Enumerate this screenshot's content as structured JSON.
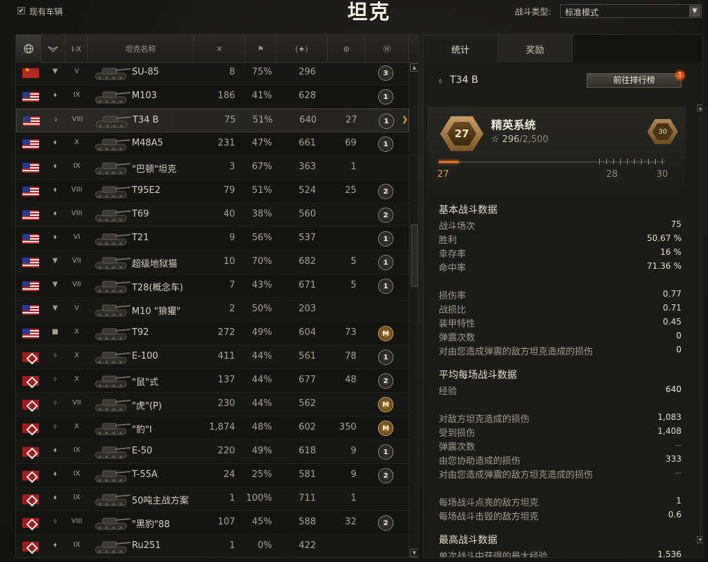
{
  "header": {
    "owned_filter_label": "现有车辆",
    "owned_filter_checked": true,
    "title": "坦克",
    "battle_type_label": "战斗类型:",
    "battle_type_value": "标准模式"
  },
  "columns": {
    "nation_icon": "globe-icon",
    "class_icon": "vehicle-class-icon",
    "tier_label": "I-X",
    "name_label": "坦克名称",
    "battles_icon": "crossed-swords-icon",
    "wins_icon": "flag-icon",
    "xp_icon": "star-icon",
    "marks_icon": "gun-marks-icon",
    "mastery_icon": "mastery-icon"
  },
  "tanks": [
    {
      "nation": "ussr",
      "cls": "▼",
      "tier": "V",
      "name": "SU-85",
      "battles": "8",
      "win": "75%",
      "xp": "296",
      "marks": "",
      "mastery": "3"
    },
    {
      "nation": "usa",
      "cls": "⬧",
      "tier": "IX",
      "name": "M103",
      "battles": "186",
      "win": "41%",
      "xp": "628",
      "marks": "",
      "mastery": "1"
    },
    {
      "nation": "usa",
      "cls": "⬨",
      "tier": "VIII",
      "name": "T34 B",
      "battles": "75",
      "win": "51%",
      "xp": "640",
      "marks": "27",
      "mastery": "1"
    },
    {
      "nation": "usa",
      "cls": "⬧",
      "tier": "X",
      "name": "M48A5",
      "battles": "231",
      "win": "47%",
      "xp": "661",
      "marks": "69",
      "mastery": "1"
    },
    {
      "nation": "usa",
      "cls": "⬧",
      "tier": "IX",
      "name": "\"巴顿\"坦克",
      "battles": "3",
      "win": "67%",
      "xp": "363",
      "marks": "1",
      "mastery": ""
    },
    {
      "nation": "usa",
      "cls": "⬧",
      "tier": "VIII",
      "name": "T95E2",
      "battles": "79",
      "win": "51%",
      "xp": "524",
      "marks": "25",
      "mastery": "2"
    },
    {
      "nation": "usa",
      "cls": "⬧",
      "tier": "VIII",
      "name": "T69",
      "battles": "40",
      "win": "38%",
      "xp": "560",
      "marks": "",
      "mastery": "2"
    },
    {
      "nation": "usa",
      "cls": "⬧",
      "tier": "VI",
      "name": "T21",
      "battles": "9",
      "win": "56%",
      "xp": "537",
      "marks": "",
      "mastery": "1"
    },
    {
      "nation": "usa",
      "cls": "▼",
      "tier": "VII",
      "name": "超级地狱猫",
      "battles": "10",
      "win": "70%",
      "xp": "682",
      "marks": "5",
      "mastery": "1"
    },
    {
      "nation": "usa",
      "cls": "▼",
      "tier": "VII",
      "name": "T28(概念车)",
      "battles": "7",
      "win": "43%",
      "xp": "671",
      "marks": "5",
      "mastery": "1"
    },
    {
      "nation": "usa",
      "cls": "▼",
      "tier": "V",
      "name": "M10 \"狼獾\"",
      "battles": "2",
      "win": "50%",
      "xp": "203",
      "marks": "",
      "mastery": ""
    },
    {
      "nation": "usa",
      "cls": "■",
      "tier": "X",
      "name": "T92",
      "battles": "272",
      "win": "49%",
      "xp": "604",
      "marks": "73",
      "mastery": "M"
    },
    {
      "nation": "ger",
      "cls": "⬨",
      "tier": "X",
      "name": "E-100",
      "battles": "411",
      "win": "44%",
      "xp": "561",
      "marks": "78",
      "mastery": "1"
    },
    {
      "nation": "ger",
      "cls": "⬨",
      "tier": "X",
      "name": "\"鼠\"式",
      "battles": "137",
      "win": "44%",
      "xp": "677",
      "marks": "48",
      "mastery": "2"
    },
    {
      "nation": "ger",
      "cls": "⬨",
      "tier": "VII",
      "name": "\"虎\"(P)",
      "battles": "230",
      "win": "44%",
      "xp": "562",
      "marks": "",
      "mastery": "M"
    },
    {
      "nation": "ger",
      "cls": "⬨",
      "tier": "X",
      "name": "\"豹\"I",
      "battles": "1,874",
      "win": "48%",
      "xp": "602",
      "marks": "350",
      "mastery": "M"
    },
    {
      "nation": "ger",
      "cls": "⬧",
      "tier": "IX",
      "name": "E-50",
      "battles": "220",
      "win": "49%",
      "xp": "618",
      "marks": "9",
      "mastery": "1"
    },
    {
      "nation": "ger",
      "cls": "⬧",
      "tier": "IX",
      "name": "T-55A",
      "battles": "24",
      "win": "25%",
      "xp": "581",
      "marks": "9",
      "mastery": "2"
    },
    {
      "nation": "ger",
      "cls": "⬧",
      "tier": "IX",
      "name": "50吨主战方案",
      "battles": "1",
      "win": "100%",
      "xp": "711",
      "marks": "1",
      "mastery": ""
    },
    {
      "nation": "ger",
      "cls": "⬨",
      "tier": "VIII",
      "name": "\"黑豹\"88",
      "battles": "107",
      "win": "45%",
      "xp": "588",
      "marks": "32",
      "mastery": "2"
    },
    {
      "nation": "ger",
      "cls": "⬧",
      "tier": "IX",
      "name": "Ru251",
      "battles": "1",
      "win": "0%",
      "xp": "422",
      "marks": "",
      "mastery": ""
    }
  ],
  "selected_index": 2,
  "detail": {
    "tabs": [
      "统计",
      "奖励"
    ],
    "vehicle_name": "T34 B",
    "rank_button": "前往排行榜",
    "rank_badge": "1",
    "elite_title": "精英系统",
    "elite_current": "296",
    "elite_total": "/2,500",
    "elite_level": "27",
    "elite_next_emblem": "30",
    "progress_fraction": 0.09,
    "progress_labels": {
      "start": "27",
      "mid": "28",
      "end": "30"
    },
    "sections": [
      {
        "title": "基本战斗数据",
        "rows": [
          {
            "label": "战斗场次",
            "value": "75"
          },
          {
            "label": "胜利",
            "value": "50.67 %"
          },
          {
            "label": "幸存率",
            "value": "16 %"
          },
          {
            "label": "命中率",
            "value": "71.36 %"
          },
          {
            "label": "",
            "value": ""
          },
          {
            "label": "损伤率",
            "value": "0.77"
          },
          {
            "label": "战损比",
            "value": "0.71"
          },
          {
            "label": "装甲特性",
            "value": "0.45"
          },
          {
            "label": "弹震次数",
            "value": "0"
          },
          {
            "label": "对由您造成弹震的敌方坦克造成的损伤",
            "value": "0"
          }
        ]
      },
      {
        "title": "平均每场战斗数据",
        "rows": [
          {
            "label": "经验",
            "value": "640"
          },
          {
            "label": "",
            "value": ""
          },
          {
            "label": "对敌方坦克造成的损伤",
            "value": "1,083"
          },
          {
            "label": "受到损伤",
            "value": "1,408"
          },
          {
            "label": "弹震次数",
            "value": "--"
          },
          {
            "label": "由您协助造成的损伤",
            "value": "333"
          },
          {
            "label": "对由您造成弹震的敌方坦克造成的损伤",
            "value": "--"
          },
          {
            "label": "",
            "value": ""
          },
          {
            "label": "每场战斗点亮的敌方坦克",
            "value": "1"
          },
          {
            "label": "每场战斗击毁的敌方坦克",
            "value": "0.6"
          }
        ]
      },
      {
        "title": "最高战斗数据",
        "rows": [
          {
            "label": "单次战斗中获得的最大经验",
            "value": "1,536"
          }
        ]
      }
    ]
  },
  "colors": {
    "accent": "#e06b1c",
    "selected_arrow": "#e7a12a",
    "mastery_gold": "#d8a85a"
  }
}
